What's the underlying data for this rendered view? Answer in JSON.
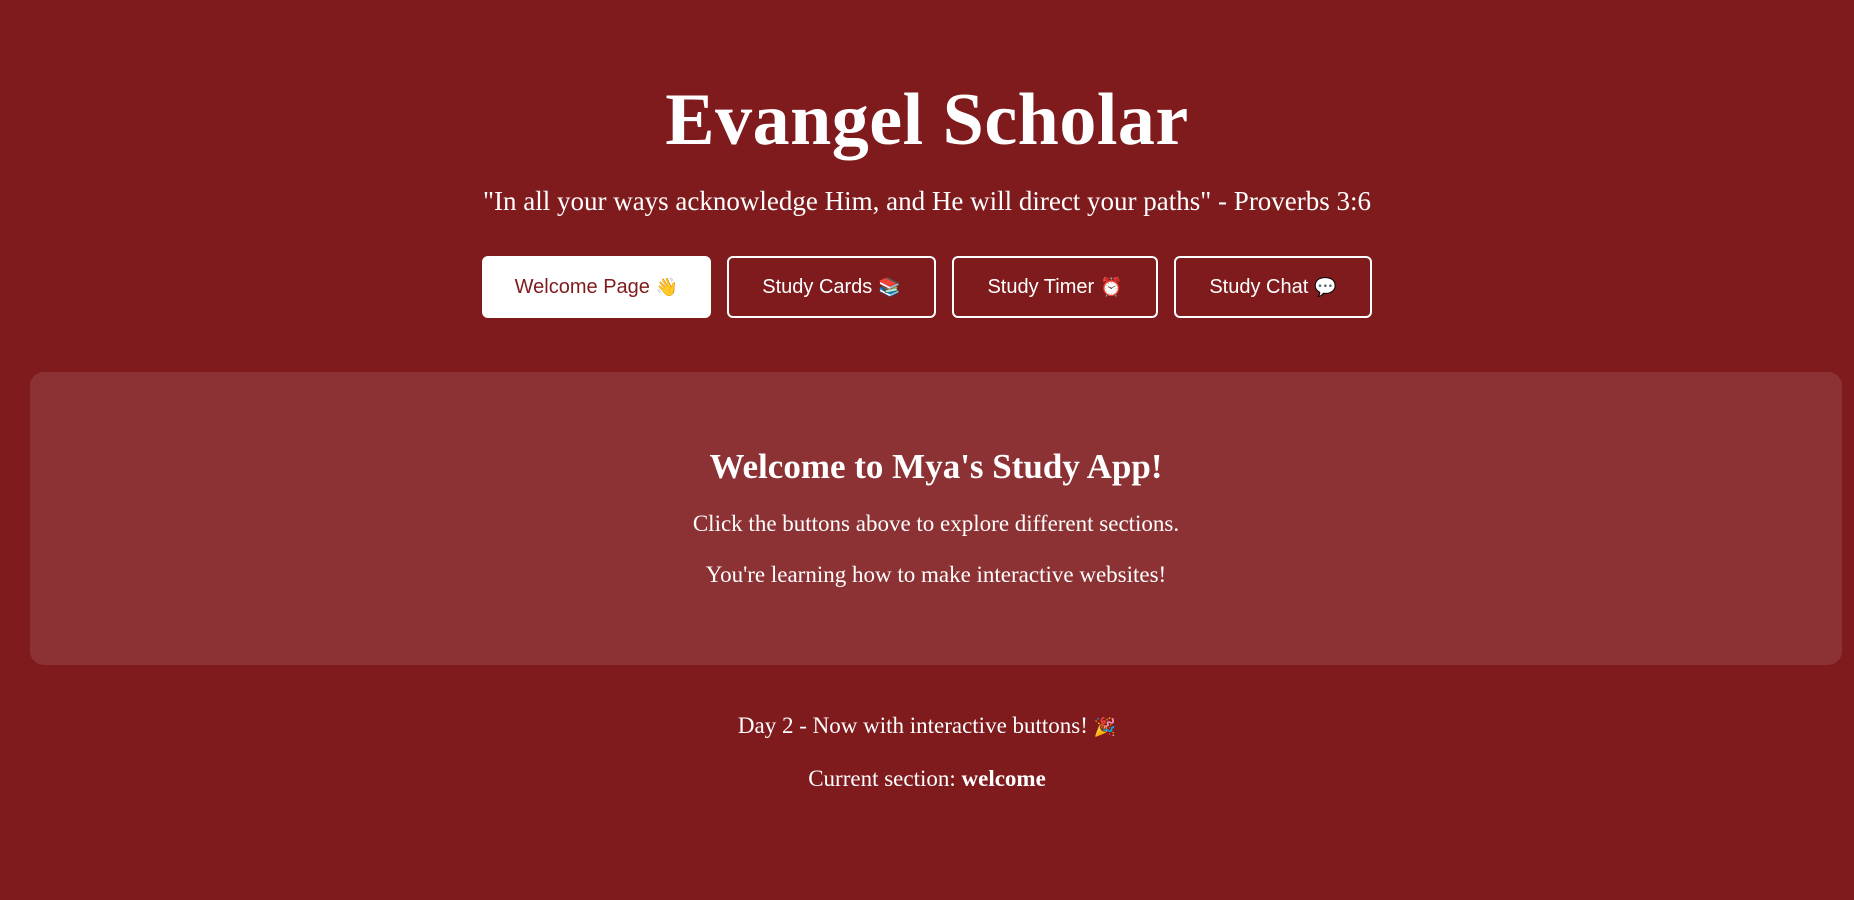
{
  "header": {
    "title": "Evangel Scholar",
    "verse": "\"In all your ways acknowledge Him, and He will direct your paths\" - Proverbs 3:6"
  },
  "nav": {
    "buttons": [
      {
        "label": "Welcome Page",
        "emoji": "👋",
        "active": true
      },
      {
        "label": "Study Cards",
        "emoji": "📚",
        "active": false
      },
      {
        "label": "Study Timer",
        "emoji": "⏰",
        "active": false
      },
      {
        "label": "Study Chat",
        "emoji": "💬",
        "active": false
      }
    ]
  },
  "panel": {
    "heading": "Welcome to Mya's Study App!",
    "line1": "Click the buttons above to explore different sections.",
    "line2": "You're learning how to make interactive websites!"
  },
  "footer": {
    "day_text": "Day 2 - Now with interactive buttons!",
    "day_emoji": "🎉",
    "section_prefix": "Current section:",
    "section_value": "welcome"
  },
  "colors": {
    "background": "#7f1b1d",
    "text": "#ffffff",
    "panel": "rgba(255,255,255,0.1)"
  }
}
